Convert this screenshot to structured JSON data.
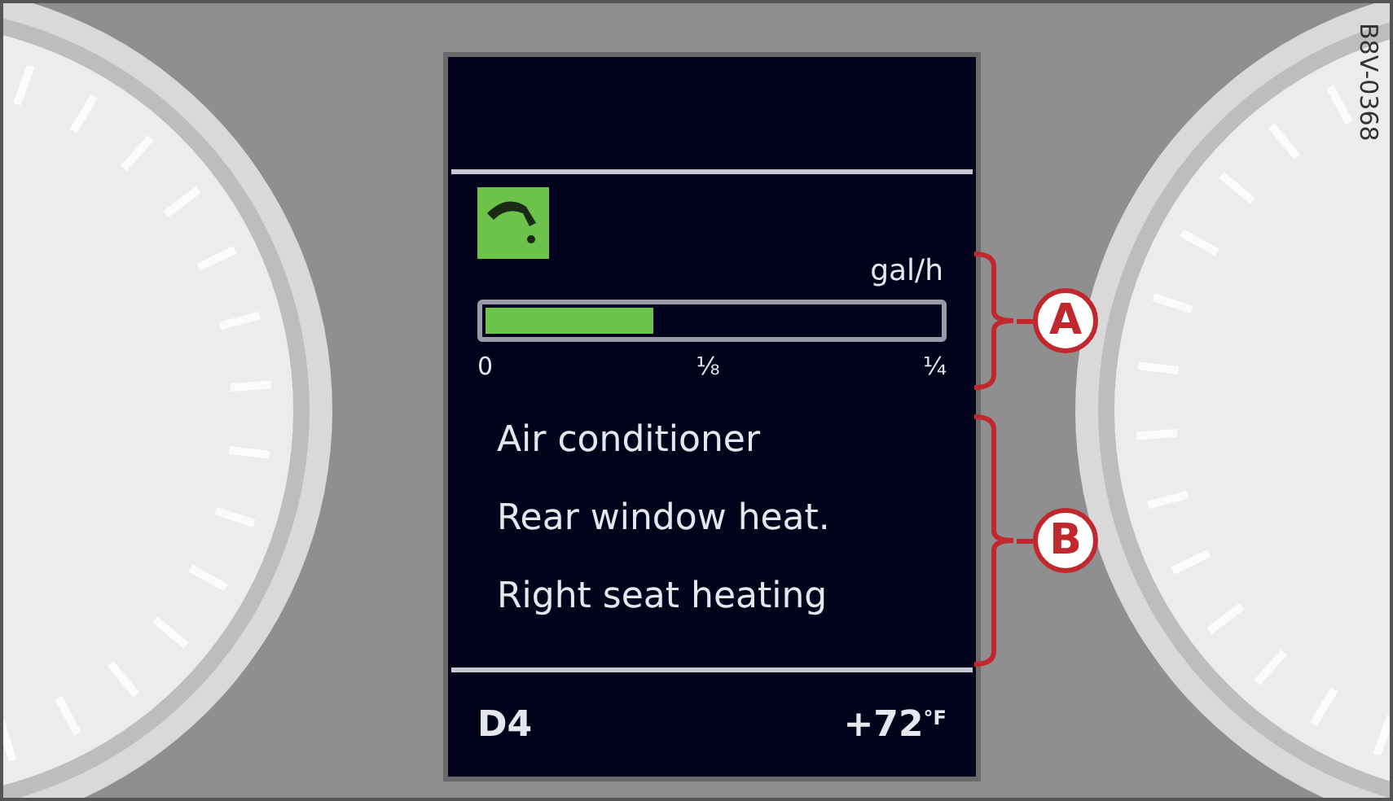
{
  "display": {
    "consumption": {
      "unit": "gal/h",
      "level": 0.37,
      "ticks": [
        "0",
        "⅛",
        "¼"
      ]
    },
    "consumers": [
      "Air conditioner",
      "Rear window heat.",
      "Right seat heating"
    ],
    "status": {
      "gear": "D4",
      "temperature": "+72",
      "temperature_unit": "°F"
    }
  },
  "callouts": [
    {
      "label": "A",
      "kind": "short"
    },
    {
      "label": "B",
      "kind": "long"
    }
  ],
  "figure_code": "B8V-0368"
}
